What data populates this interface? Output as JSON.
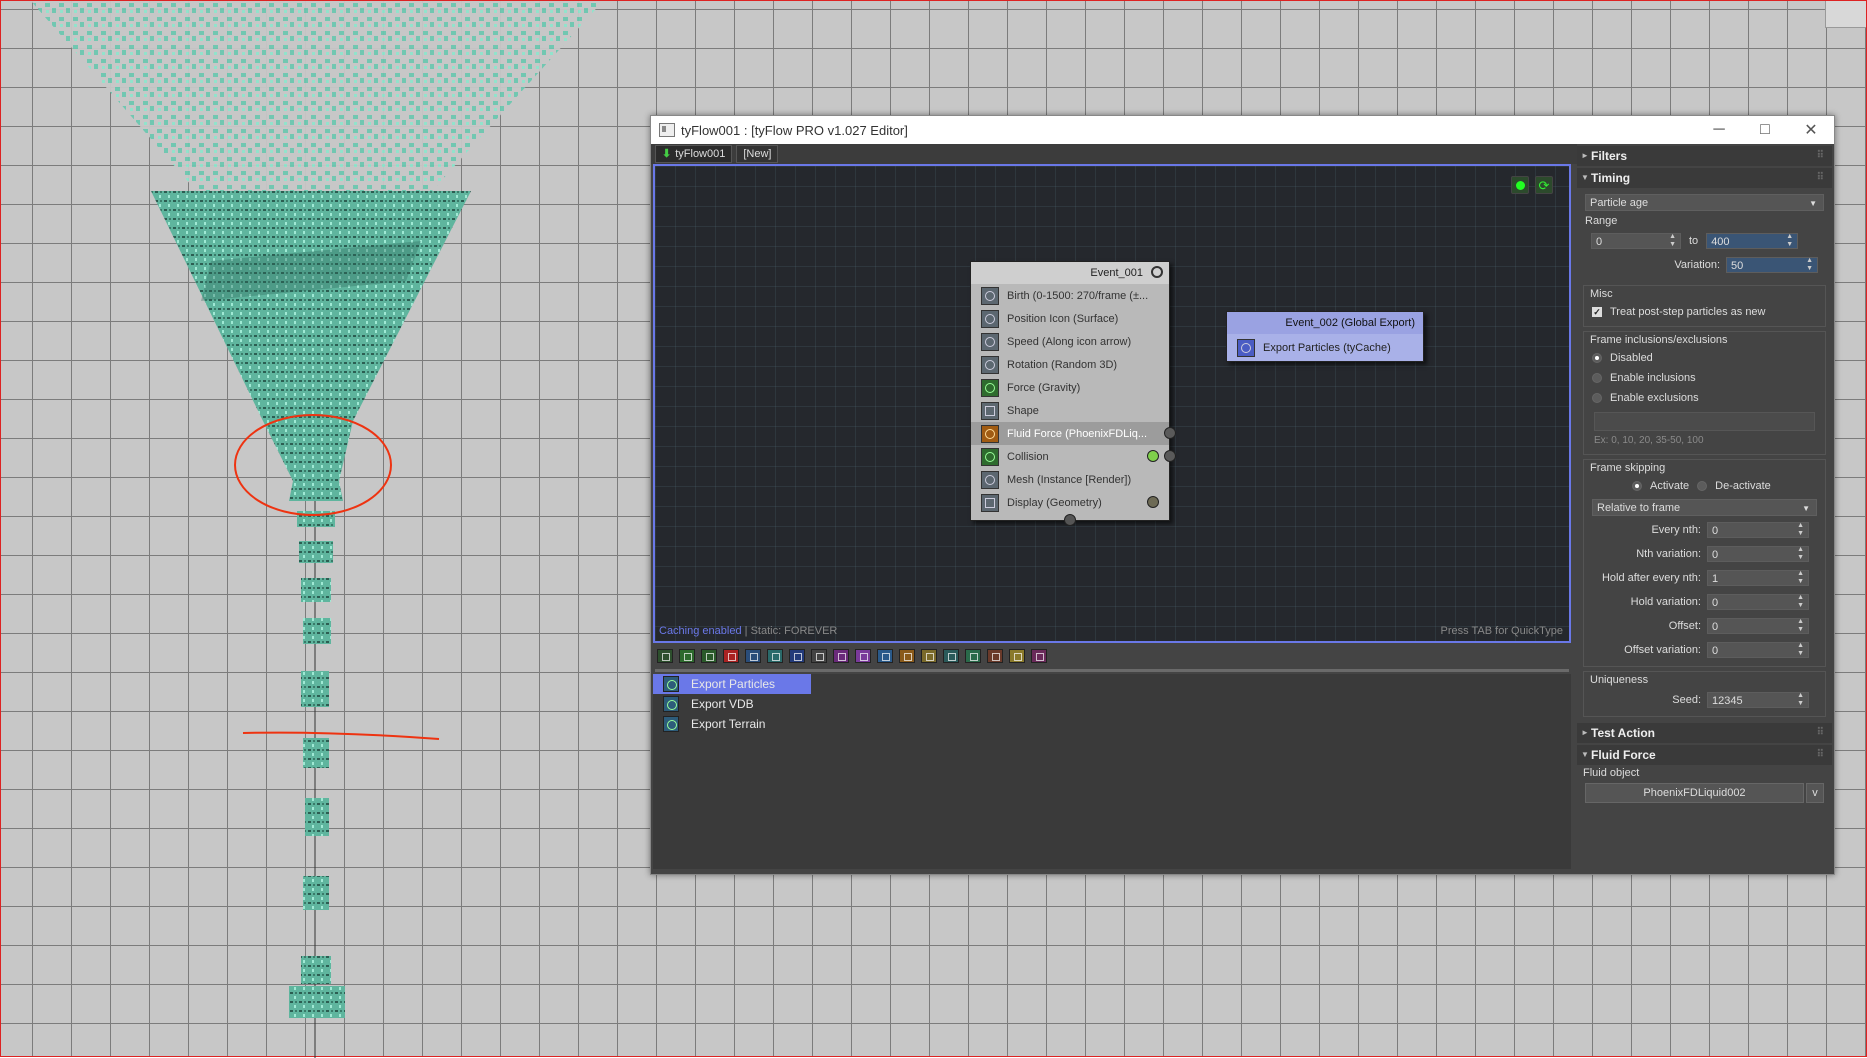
{
  "window": {
    "title": "tyFlow001 : [tyFlow PRO v1.027 Editor]",
    "controls": {
      "minimize": "─",
      "maximize": "□",
      "close": "✕"
    }
  },
  "tabs": [
    {
      "label": "tyFlow001"
    },
    {
      "label": "[New]"
    }
  ],
  "canvas": {
    "status_caching": "Caching enabled",
    "status_sep": " | ",
    "status_static": "Static: FOREVER",
    "hint": "Press TAB for QuickType"
  },
  "event1": {
    "title": "Event_001",
    "operators": [
      {
        "label": "Birth (0-1500: 270/frame (±..."
      },
      {
        "label": "Position Icon (Surface)"
      },
      {
        "label": "Speed (Along icon arrow)"
      },
      {
        "label": "Rotation (Random 3D)"
      },
      {
        "label": "Force (Gravity)"
      },
      {
        "label": "Shape"
      },
      {
        "label": "Fluid Force (PhoenixFDLiq..."
      },
      {
        "label": "Collision"
      },
      {
        "label": "Mesh (Instance [Render])"
      },
      {
        "label": "Display (Geometry)"
      }
    ]
  },
  "event2": {
    "title": "Event_002 (Global Export)",
    "operators": [
      {
        "label": "Export Particles (tyCache)"
      }
    ]
  },
  "depot": {
    "items": [
      {
        "label": "Export Particles"
      },
      {
        "label": "Export VDB"
      },
      {
        "label": "Export Terrain"
      }
    ],
    "toolbar_colors": [
      "#2d4f2d",
      "#2d6a2d",
      "#2a5a2a",
      "#a22",
      "#2a4d7a",
      "#2a6a6a",
      "#223a7a",
      "#444",
      "#6a2a7a",
      "#7a3a9a",
      "#2a5a8a",
      "#8a5a1a",
      "#7a6a2a",
      "#2a5a5a",
      "#2a6a4a",
      "#6a3a2a",
      "#8a7a2a",
      "#6a2a5a"
    ]
  },
  "panel": {
    "filters": {
      "title": "Filters"
    },
    "timing": {
      "title": "Timing",
      "mode": "Particle age",
      "range_label": "Range",
      "range_from": "0",
      "to_label": "to",
      "range_to": "400",
      "variation_label": "Variation:",
      "variation": "50"
    },
    "misc": {
      "label": "Misc",
      "treat_label": "Treat post-step particles as new"
    },
    "frame_incl": {
      "label": "Frame inclusions/exclusions",
      "options": [
        "Disabled",
        "Enable inclusions",
        "Enable exclusions"
      ],
      "hint": "Ex: 0, 10, 20, 35-50, 100"
    },
    "frame_skip": {
      "label": "Frame skipping",
      "activate": "Activate",
      "deactivate": "De-activate",
      "relative": "Relative to frame",
      "fields": [
        {
          "label": "Every nth:",
          "value": "0"
        },
        {
          "label": "Nth variation:",
          "value": "0"
        },
        {
          "label": "Hold after every nth:",
          "value": "1"
        },
        {
          "label": "Hold variation:",
          "value": "0"
        },
        {
          "label": "Offset:",
          "value": "0"
        },
        {
          "label": "Offset variation:",
          "value": "0"
        }
      ]
    },
    "uniqueness": {
      "label": "Uniqueness",
      "seed_label": "Seed:",
      "seed": "12345"
    },
    "test_action": {
      "title": "Test Action"
    },
    "fluid_force": {
      "title": "Fluid Force",
      "object_label": "Fluid object",
      "object": "PhoenixFDLiquid002",
      "picker": "v"
    }
  }
}
